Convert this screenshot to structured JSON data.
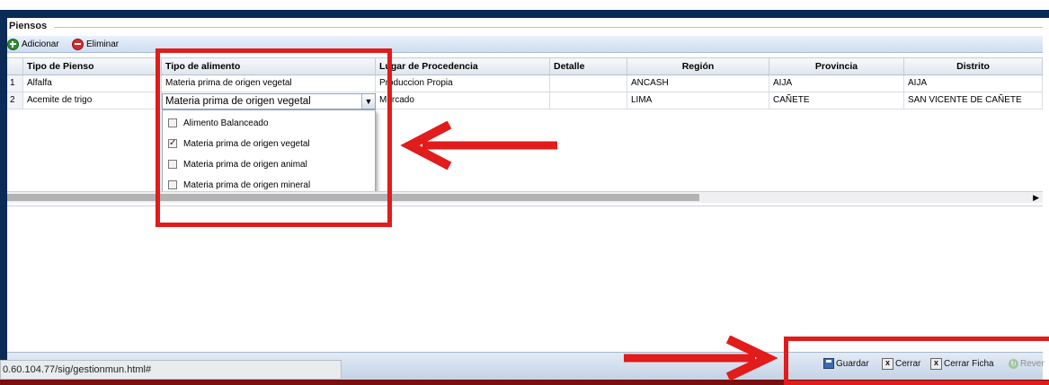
{
  "panel": {
    "legend": "Piensos"
  },
  "toolbar": {
    "add_label": "Adicionar",
    "delete_label": "Eliminar"
  },
  "grid": {
    "columns": [
      "Tipo de Pienso",
      "Tipo de alimento",
      "Lugar de Procedencia",
      "Detalle",
      "Región",
      "Provincia",
      "Distrito"
    ],
    "rows": [
      {
        "num": "1",
        "tipo_pienso": "Alfalfa",
        "tipo_alimento": "Materia prima de origen vegetal",
        "lugar": "Produccion Propia",
        "detalle": "",
        "region": "ANCASH",
        "provincia": "AIJA",
        "distrito": "AIJA"
      },
      {
        "num": "2",
        "tipo_pienso": "Acemite de trigo",
        "tipo_alimento": "Materia prima de origen vegetal",
        "lugar": "Mercado",
        "detalle": "",
        "region": "LIMA",
        "provincia": "CAÑETE",
        "distrito": "SAN VICENTE DE CAÑETE"
      }
    ]
  },
  "dropdown": {
    "selected": "Materia prima de origen vegetal",
    "options": [
      {
        "label": "Alimento Balanceado",
        "checked": false
      },
      {
        "label": "Materia prima de origen vegetal",
        "checked": true
      },
      {
        "label": "Materia prima de origen animal",
        "checked": false
      },
      {
        "label": "Materia prima de origen mineral",
        "checked": false
      }
    ]
  },
  "status": {
    "url": "0.60.104.77/sig/gestionmun.html#"
  },
  "footer": {
    "save_label": "Guardar",
    "close_label": "Cerrar",
    "close_record_label": "Cerrar Ficha",
    "revert_label": "Rever"
  },
  "colors": {
    "annotation": "#e21b1b",
    "frame": "#0b2b57"
  },
  "icons": [
    "add-icon",
    "delete-icon",
    "dropdown-arrow-icon",
    "checkbox-icon",
    "save-icon",
    "close-icon",
    "revert-icon",
    "scroll-right-icon"
  ]
}
